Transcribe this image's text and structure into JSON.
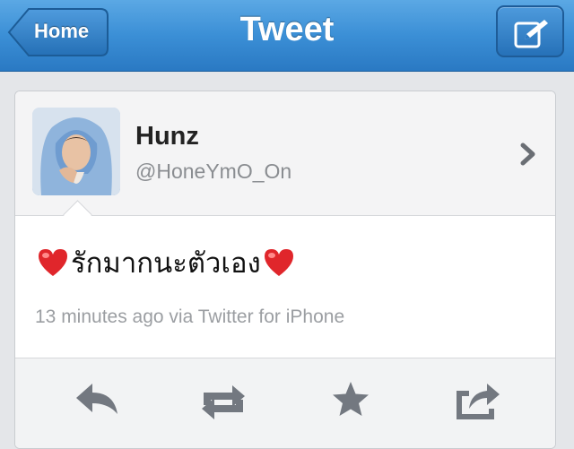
{
  "navbar": {
    "title": "Tweet",
    "back_label": "Home",
    "compose_icon": "compose-icon"
  },
  "tweet": {
    "display_name": "Hunz",
    "handle": "@HoneYmO_On",
    "text": "รักมากนะตัวเอง",
    "meta": "13 minutes ago via Twitter for iPhone",
    "avatar_icon": "profile-photo"
  },
  "actions": {
    "reply_icon": "reply-icon",
    "retweet_icon": "retweet-icon",
    "favorite_icon": "star-icon",
    "share_icon": "share-icon"
  },
  "colors": {
    "nav_blue": "#3b8fd6",
    "heart_red": "#e0262b",
    "icon_gray": "#737880"
  }
}
